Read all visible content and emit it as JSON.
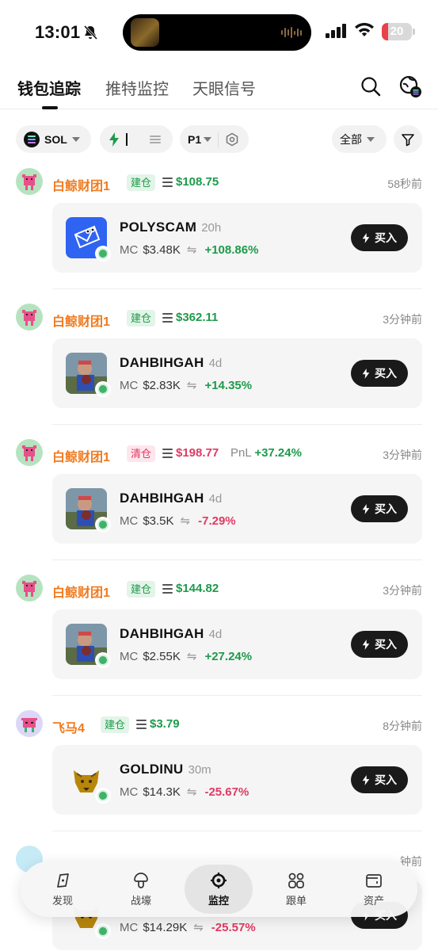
{
  "status_bar": {
    "time": "13:01",
    "battery": "20"
  },
  "tabs": [
    {
      "label": "钱包追踪"
    },
    {
      "label": "推特监控"
    },
    {
      "label": "天眼信号"
    }
  ],
  "filters": {
    "chain": "SOL",
    "page": "P1",
    "scope": "全部"
  },
  "feed": [
    {
      "wallet": "白鲸财团1",
      "action": "建仓",
      "amount": "$108.75",
      "pnl_label": "",
      "pnl": "",
      "time": "58秒前",
      "token": {
        "name": "POLYSCAM",
        "age": "20h",
        "mc_label": "MC",
        "mc": "$3.48K",
        "change": "+108.86%"
      },
      "buy_label": "买入"
    },
    {
      "wallet": "白鲸财团1",
      "action": "建仓",
      "amount": "$362.11",
      "pnl_label": "",
      "pnl": "",
      "time": "3分钟前",
      "token": {
        "name": "DAHBIHGAH",
        "age": "4d",
        "mc_label": "MC",
        "mc": "$2.83K",
        "change": "+14.35%"
      },
      "buy_label": "买入"
    },
    {
      "wallet": "白鲸财团1",
      "action": "清仓",
      "amount": "$198.77",
      "pnl_label": "PnL",
      "pnl": "+37.24%",
      "time": "3分钟前",
      "token": {
        "name": "DAHBIHGAH",
        "age": "4d",
        "mc_label": "MC",
        "mc": "$3.5K",
        "change": "-7.29%"
      },
      "buy_label": "买入"
    },
    {
      "wallet": "白鲸财团1",
      "action": "建仓",
      "amount": "$144.82",
      "pnl_label": "",
      "pnl": "",
      "time": "3分钟前",
      "token": {
        "name": "DAHBIHGAH",
        "age": "4d",
        "mc_label": "MC",
        "mc": "$2.55K",
        "change": "+27.24%"
      },
      "buy_label": "买入"
    },
    {
      "wallet": "飞马4",
      "action": "建仓",
      "amount": "$3.79",
      "pnl_label": "",
      "pnl": "",
      "time": "8分钟前",
      "token": {
        "name": "GOLDINU",
        "age": "30m",
        "mc_label": "MC",
        "mc": "$14.3K",
        "change": "-25.67%"
      },
      "buy_label": "买入"
    },
    {
      "wallet": "",
      "action": "",
      "amount": "",
      "pnl_label": "",
      "pnl": "",
      "time": "钟前",
      "token": {
        "name": "",
        "age": "",
        "mc_label": "MC",
        "mc": "$14.29K",
        "change": "-25.57%"
      },
      "buy_label": "买入"
    }
  ],
  "bottom_nav": [
    {
      "label": "发现",
      "icon": "compass-icon"
    },
    {
      "label": "战壕",
      "icon": "mushroom-icon"
    },
    {
      "label": "监控",
      "icon": "target-icon"
    },
    {
      "label": "跟单",
      "icon": "grid-icon"
    },
    {
      "label": "资产",
      "icon": "wallet-icon"
    }
  ],
  "colors": {
    "wallet_name": "#f07a1e",
    "positive": "#1e9a4b",
    "negative": "#e03a63",
    "buy_button": "#1a1a1a"
  }
}
